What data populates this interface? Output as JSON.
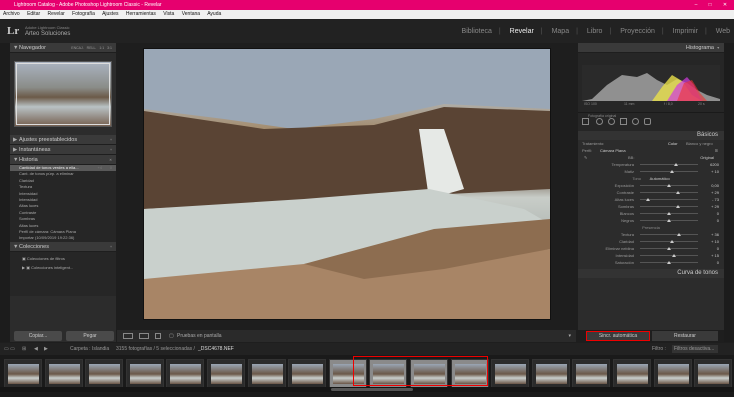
{
  "window": {
    "title": "Lightroom Catalog - Adobe Photoshop Lightroom Classic - Revelar"
  },
  "menu": [
    "Archivo",
    "Editar",
    "Revelar",
    "Fotografía",
    "Ajustes",
    "Herramientas",
    "Vista",
    "Ventana",
    "Ayuda"
  ],
  "identity": {
    "logo": "Lr",
    "catalog": "Adobe Lightroom Classic",
    "user": "Arteo Soluciones"
  },
  "modules": [
    "Biblioteca",
    "Revelar",
    "Mapa",
    "Libro",
    "Proyección",
    "Imprimir",
    "Web"
  ],
  "active_module": "Revelar",
  "left": {
    "navigator": {
      "title": "Navegador",
      "modes": [
        "ENCAJ.",
        "RELL.",
        "1:1",
        "3:1"
      ]
    },
    "presets": "Ajustes preestablecidos",
    "snapshots": "Instantáneas",
    "history": {
      "title": "Historia",
      "rows": [
        {
          "label": "Cantidad de tonos verdes a ella...",
          "v1": "+4",
          "v2": "0"
        },
        {
          "label": "Cant. de tonos púrp. a eliminar",
          "v1": "",
          "v2": ""
        },
        {
          "label": "Claridad",
          "v1": "",
          "v2": ""
        },
        {
          "label": "Textura",
          "v1": "",
          "v2": ""
        },
        {
          "label": "Intensidad",
          "v1": "",
          "v2": ""
        },
        {
          "label": "Intensidad",
          "v1": "",
          "v2": ""
        },
        {
          "label": "Altas luces",
          "v1": "",
          "v2": ""
        },
        {
          "label": "Contraste",
          "v1": "",
          "v2": ""
        },
        {
          "label": "Sombras",
          "v1": "",
          "v2": ""
        },
        {
          "label": "Altas luces",
          "v1": "",
          "v2": ""
        },
        {
          "label": "Perfil de cámara: Cámara Plana",
          "v1": "",
          "v2": ""
        },
        {
          "label": "Importar (10/09/2019 19:22:36)",
          "v1": "",
          "v2": ""
        }
      ]
    },
    "collections": {
      "title": "Colecciones",
      "items": [
        "Colecciones de filtros",
        "Colecciones inteligent..."
      ]
    },
    "copy": "Copiar...",
    "paste": "Pegar"
  },
  "toolbar": {
    "proof": "Pruebas en pantalla"
  },
  "right": {
    "histogram": {
      "title": "Histograma",
      "iso": "ISO 100",
      "focal": "11 mm",
      "aperture": "f / 8,0",
      "shutter": "20 s",
      "original": "Fotografía original"
    },
    "basic": {
      "title": "Básicos",
      "treatment_label": "Tratamiento:",
      "treat_color": "Color",
      "treat_bw": "Blanco y negro",
      "profile_label": "Perfil:",
      "profile": "Cámara Plana",
      "wb_label": "BB:",
      "wb": "Original",
      "sliders1": [
        {
          "label": "Temperatura",
          "val": "6200",
          "pos": 0.62
        },
        {
          "label": "Matiz",
          "val": "+ 10",
          "pos": 0.55
        }
      ],
      "tone_label": "Tono",
      "auto": "Automático",
      "sliders2": [
        {
          "label": "Exposición",
          "val": "0,00",
          "pos": 0.5
        },
        {
          "label": "Contraste",
          "val": "+ 29",
          "pos": 0.65
        },
        {
          "label": "Altas luces",
          "val": "- 73",
          "pos": 0.13
        },
        {
          "label": "Sombras",
          "val": "+ 29",
          "pos": 0.65
        },
        {
          "label": "Blancos",
          "val": "0",
          "pos": 0.5
        },
        {
          "label": "Negros",
          "val": "0",
          "pos": 0.5
        }
      ],
      "presence_label": "Presencia",
      "sliders3": [
        {
          "label": "Textura",
          "val": "+ 36",
          "pos": 0.68
        },
        {
          "label": "Claridad",
          "val": "+ 10",
          "pos": 0.55
        },
        {
          "label": "Eliminar neblina",
          "val": "0",
          "pos": 0.5
        },
        {
          "label": "Intensidad",
          "val": "+ 15",
          "pos": 0.58
        },
        {
          "label": "Saturación",
          "val": "0",
          "pos": 0.5
        }
      ]
    },
    "curve": "Curva de tonos",
    "sync": "Sincr. automática",
    "reset": "Restaurar"
  },
  "filmbar": {
    "folder": "Carpeta : Islandia",
    "count": "3155 fotografías / 5 seleccionadas /",
    "file": "_DSC4678.NEF",
    "filter_label": "Filtro :",
    "filter": "Filtros desactiva..."
  },
  "filmstrip": {
    "count": 18,
    "selected": [
      8,
      9,
      10,
      11
    ]
  }
}
